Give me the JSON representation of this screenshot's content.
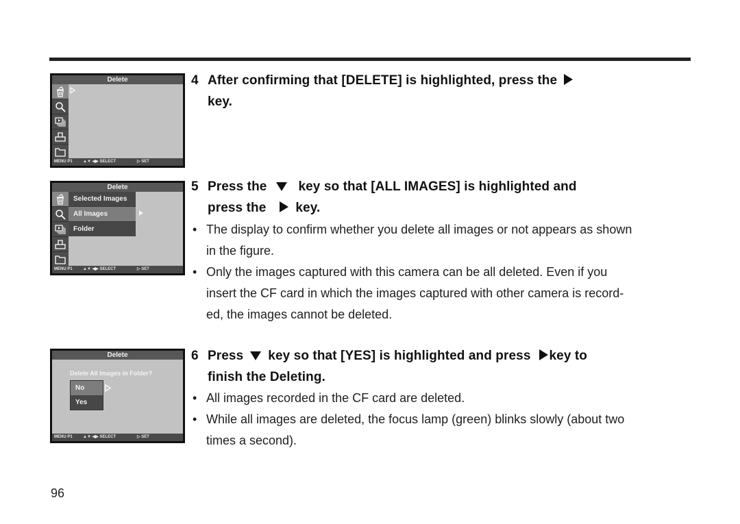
{
  "page_number": "96",
  "screens": [
    {
      "title": "Delete",
      "footer": {
        "menu": "MENU P1",
        "nav": "▲▼  ◀▶  SELECT",
        "set": "▷ SET"
      },
      "side_icons": [
        "delete-icon",
        "magnify-icon",
        "slideshow-icon",
        "print-icon",
        "folder-icon"
      ]
    },
    {
      "title": "Delete",
      "footer": {
        "menu": "MENU P1",
        "nav": "▲▼  ◀▶  SELECT",
        "set": "▷ SET"
      },
      "menu_items": [
        "Selected Images",
        "All Images",
        "Folder"
      ],
      "selected_item": "All Images"
    },
    {
      "title": "Delete",
      "footer": {
        "menu": "MENU P1",
        "nav": "▲▼  ◀▶  SELECT",
        "set": "▷ SET"
      },
      "prompt": "Delete All Images in Folder?",
      "options": [
        "No",
        "Yes"
      ],
      "selected_option": "No"
    }
  ],
  "steps": {
    "s4": {
      "num": "4",
      "line1a": "After confirming that [DELETE] is highlighted, press the",
      "line2": "key."
    },
    "s5": {
      "num": "5",
      "line1a": "Press the",
      "line1b": "key so that [ALL IMAGES] is highlighted and",
      "line2a": "press the",
      "line2b": "key.",
      "bullets": [
        {
          "line1": "The display to confirm whether you delete all images or not appears as shown",
          "line2": "in the figure."
        },
        {
          "line1": "Only the images captured with this camera can be all deleted. Even if you",
          "line2": "insert the CF card in which the images captured with other camera is record-",
          "line3": "ed, the images cannot be deleted."
        }
      ]
    },
    "s6": {
      "num": "6",
      "line1a": "Press",
      "line1b": "key so that [YES] is highlighted and press",
      "line1c": "key to",
      "line2": "finish the Deleting.",
      "bullets": [
        {
          "line1": "All images recorded in the CF card are deleted."
        },
        {
          "line1": "While all images are deleted, the focus lamp (green) blinks slowly (about two",
          "line2": "times a second)."
        }
      ]
    }
  },
  "bullet_char": "•"
}
